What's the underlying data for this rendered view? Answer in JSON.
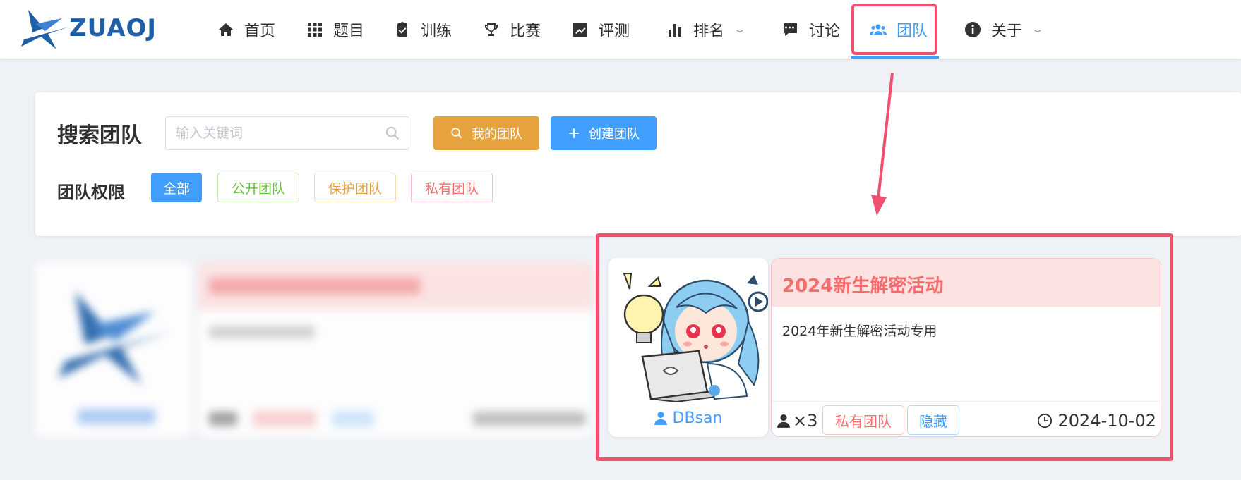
{
  "brand": {
    "logo_text": "ZUAOJ"
  },
  "nav": {
    "items": [
      {
        "label": "首页",
        "icon": "home-icon"
      },
      {
        "label": "题目",
        "icon": "grid-icon"
      },
      {
        "label": "训练",
        "icon": "clipboard-check-icon"
      },
      {
        "label": "比赛",
        "icon": "trophy-icon"
      },
      {
        "label": "评测",
        "icon": "line-chart-icon"
      },
      {
        "label": "排名",
        "icon": "bar-chart-icon",
        "dropdown": true
      },
      {
        "label": "讨论",
        "icon": "comment-icon"
      },
      {
        "label": "团队",
        "icon": "users-icon",
        "active": true
      },
      {
        "label": "关于",
        "icon": "info-icon",
        "dropdown": true
      }
    ]
  },
  "search": {
    "title": "搜索团队",
    "placeholder": "输入关键词",
    "my_teams_label": "我的团队",
    "create_team_label": "创建团队"
  },
  "filters": {
    "label": "团队权限",
    "options": [
      "全部",
      "公开团队",
      "保护团队",
      "私有团队"
    ],
    "selected": "全部"
  },
  "team_card": {
    "owner": "DBsan",
    "title": "2024新生解密活动",
    "description": "2024年新生解密活动专用",
    "member_count": "×3",
    "privacy_tag": "私有团队",
    "visibility_tag": "隐藏",
    "created_date": "2024-10-02"
  },
  "colors": {
    "primary": "#409eff",
    "warning": "#e6a23c",
    "success": "#67c23a",
    "danger": "#f56c6c",
    "annotation": "#f0506e"
  }
}
